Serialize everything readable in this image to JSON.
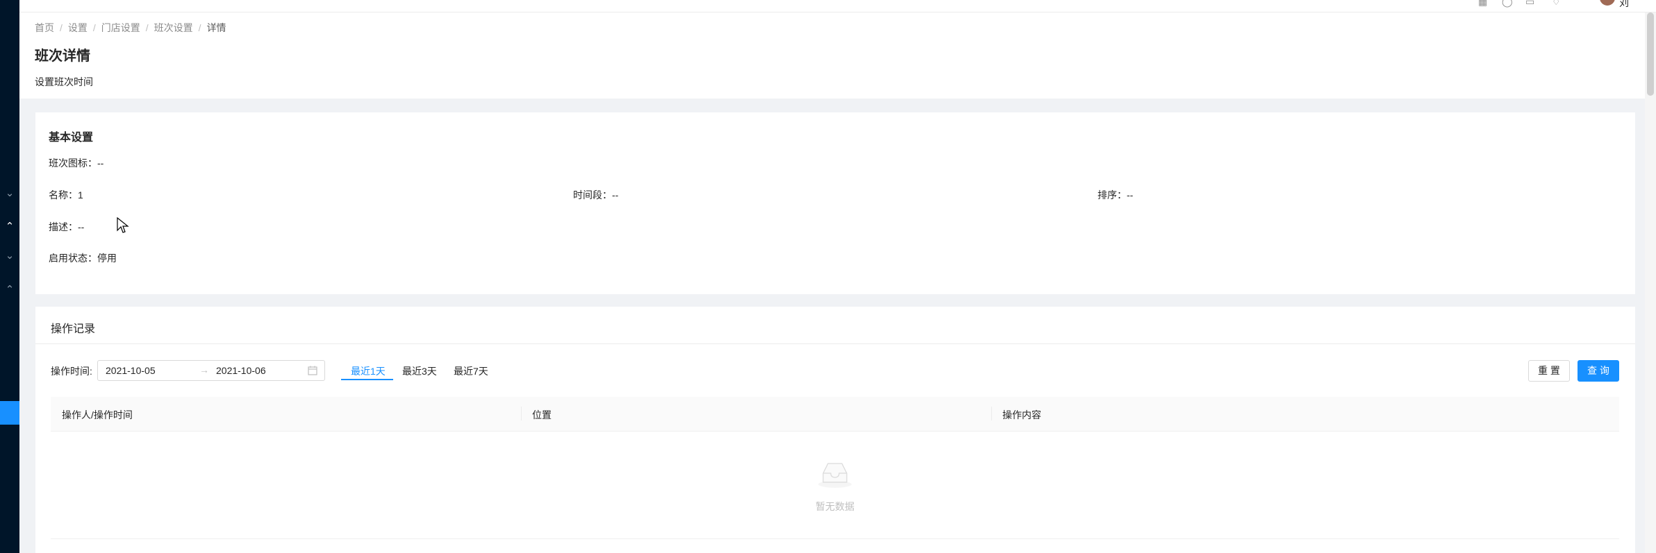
{
  "topbar": {
    "icons": [
      "grid-icon",
      "help-icon",
      "apps-icon",
      "bell-icon"
    ],
    "user_initial": "刘"
  },
  "breadcrumb": {
    "items": [
      "首页",
      "设置",
      "门店设置",
      "班次设置"
    ],
    "current": "详情",
    "separator": "/"
  },
  "page": {
    "title": "班次详情",
    "subtitle": "设置班次时间"
  },
  "basic": {
    "title": "基本设置",
    "icon_label": "班次图标：",
    "icon_value": "--",
    "name_label": "名称：",
    "name_value": "1",
    "period_label": "时间段：",
    "period_value": "--",
    "sort_label": "排序：",
    "sort_value": "--",
    "desc_label": "描述：",
    "desc_value": "--",
    "status_label": "启用状态：",
    "status_value": "停用"
  },
  "record": {
    "title": "操作记录",
    "time_label": "操作时间:",
    "start_date": "2021-10-05",
    "arrow": "→",
    "end_date": "2021-10-06",
    "quick": [
      "最近1天",
      "最近3天",
      "最近7天"
    ],
    "active_quick": "最近1天",
    "reset": "重 置",
    "query": "查 询",
    "columns": [
      "操作人/操作时间",
      "位置",
      "操作内容"
    ],
    "empty": "暂无数据"
  },
  "colors": {
    "primary": "#1890ff",
    "sidebar": "#001529"
  }
}
